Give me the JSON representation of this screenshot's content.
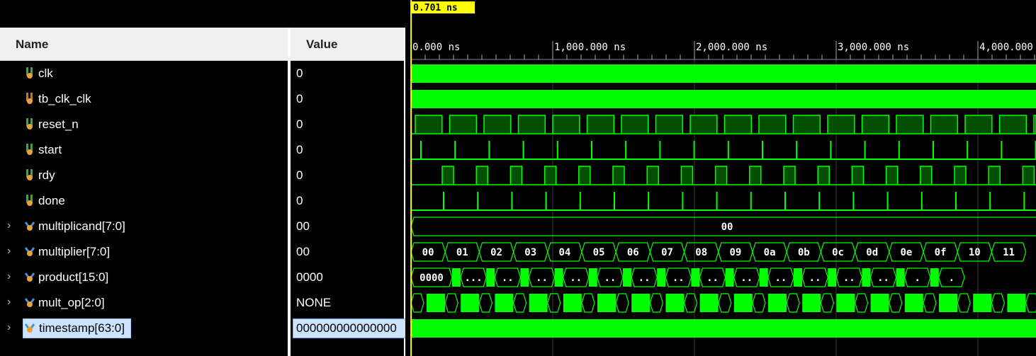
{
  "columns": {
    "name": "Name",
    "value": "Value"
  },
  "cursor": {
    "label": "0.701 ns",
    "time_ns": 0.701
  },
  "timeline": {
    "start_ns": 0,
    "ns_per_1000": 1000,
    "ticks": [
      "0.000 ns",
      "1,000.000 ns",
      "2,000.000 ns",
      "3,000.000 ns",
      "4,000.000 ns"
    ]
  },
  "signals": [
    {
      "name": "clk",
      "value": "0",
      "icon": "wire-icon",
      "expandable": false
    },
    {
      "name": "tb_clk_clk",
      "value": "0",
      "icon": "wire-orange-icon",
      "expandable": false
    },
    {
      "name": "reset_n",
      "value": "0",
      "icon": "wire-icon",
      "expandable": false
    },
    {
      "name": "start",
      "value": "0",
      "icon": "wire-icon",
      "expandable": false
    },
    {
      "name": "rdy",
      "value": "0",
      "icon": "wire-icon",
      "expandable": false
    },
    {
      "name": "done",
      "value": "0",
      "icon": "wire-icon",
      "expandable": false
    },
    {
      "name": "multiplicand[7:0]",
      "value": "00",
      "icon": "bus-icon",
      "expandable": true
    },
    {
      "name": "multiplier[7:0]",
      "value": "00",
      "icon": "bus-icon",
      "expandable": true
    },
    {
      "name": "product[15:0]",
      "value": "0000",
      "icon": "bus-icon",
      "expandable": true
    },
    {
      "name": "mult_op[2:0]",
      "value": "NONE",
      "icon": "bus-icon",
      "expandable": true
    },
    {
      "name": "timestamp[63:0]",
      "value": "000000000000000",
      "icon": "bus-orange-icon",
      "expandable": true,
      "selected": true
    }
  ],
  "bus_labels": {
    "multiplicand": "00",
    "multiplier": [
      "00",
      "01",
      "02",
      "03",
      "04",
      "05",
      "06",
      "07",
      "08",
      "09",
      "0a",
      "0b",
      "0c",
      "0d",
      "0e",
      "0f",
      "10",
      "11"
    ],
    "product_first": "0000",
    "product_segments": [
      "...",
      "..",
      "..",
      "..",
      "..",
      "..",
      "..",
      "..",
      "..",
      "..",
      "..",
      "..",
      "..",
      ".",
      "."
    ]
  },
  "colors": {
    "wave": "#00ff00",
    "wave_dark": "#005000",
    "cursor": "#ffff00",
    "grid": "#3a3a3a",
    "selection": "#cce4ff"
  }
}
